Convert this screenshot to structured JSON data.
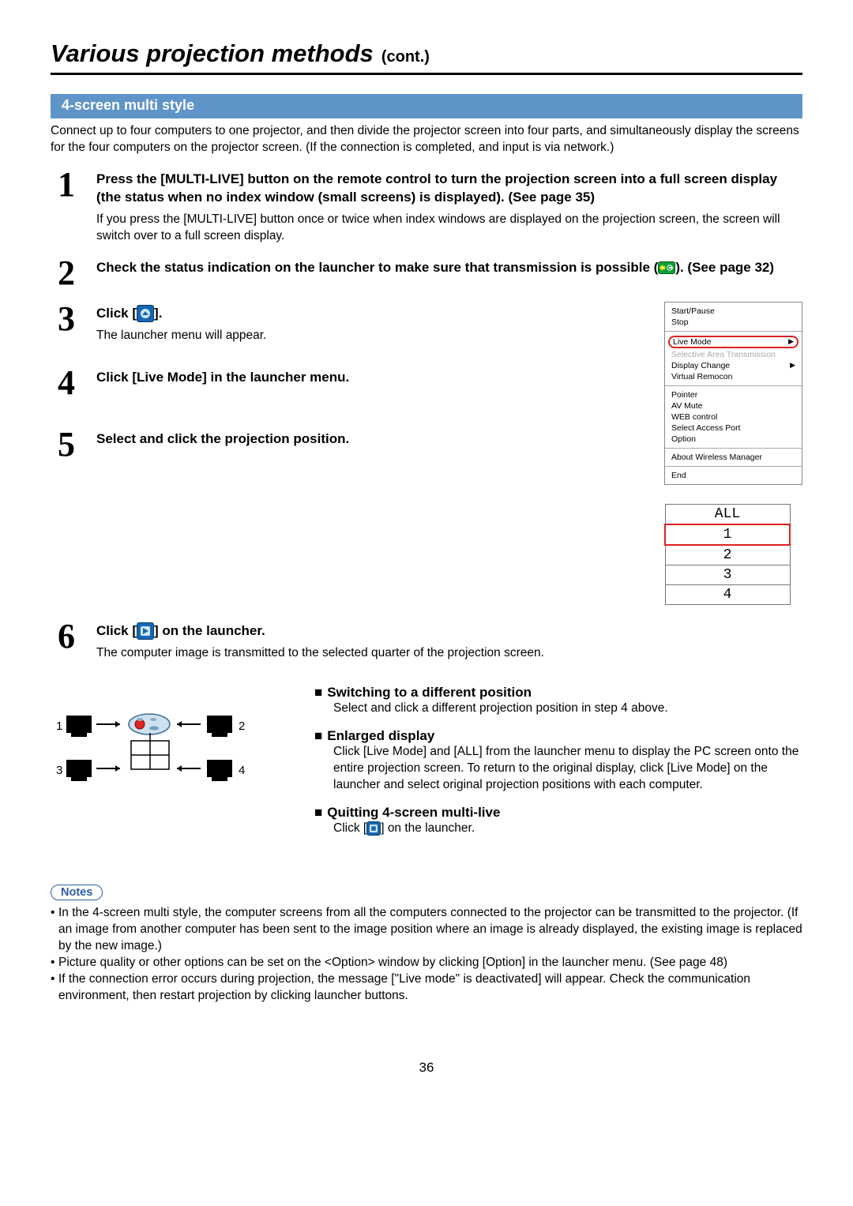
{
  "title": {
    "main": "Various projection methods",
    "sub": "(cont.)"
  },
  "section_bar": "4-screen multi style",
  "intro": "Connect up to four computers to one projector, and then divide the projector screen into four parts, and simultaneously display the screens for the four computers on the projector screen. (If the connection is completed, and input is via network.)",
  "step1": {
    "num": "1",
    "head": "Press the [MULTI-LIVE] button on the remote control to turn the projection screen into a full screen display (the status when no index window (small screens) is displayed). (See page 35)",
    "desc": "If you press the [MULTI-LIVE] button once or twice when index windows are displayed on the projection screen, the screen will switch over to a full screen display."
  },
  "step2": {
    "num": "2",
    "head_a": "Check the status indication on the launcher to make sure that transmission is possible (",
    "head_b": "). (See page 32)"
  },
  "step3": {
    "num": "3",
    "head_a": "Click [",
    "head_b": "].",
    "desc": "The launcher menu will appear."
  },
  "step4": {
    "num": "4",
    "head": "Click [Live Mode] in the launcher menu."
  },
  "step5": {
    "num": "5",
    "head": "Select and click the projection position."
  },
  "step6": {
    "num": "6",
    "head_a": "Click [",
    "head_b": "] on the launcher.",
    "desc": "The computer image is transmitted to the selected quarter of the projection screen."
  },
  "menu": {
    "g1": [
      "Start/Pause",
      "Stop"
    ],
    "live_mode": "Live Mode",
    "g2b": [
      "Selective Area Transmission",
      "Display Change",
      "Virtual Remocon"
    ],
    "g3": [
      "Pointer",
      "AV Mute",
      "WEB control",
      "Select Access Port",
      "Option"
    ],
    "g4": "About Wireless Manager",
    "g5": "End"
  },
  "positions": {
    "all": "ALL",
    "rows": [
      "1",
      "2",
      "3",
      "4"
    ]
  },
  "sub_switch": {
    "title": "Switching to a different position",
    "body": "Select and click a different projection position in step 4 above."
  },
  "sub_enlarged": {
    "title": "Enlarged display",
    "body": "Click [Live Mode] and [ALL] from the launcher menu to display the PC screen onto the entire projection screen. To return to the original display, click [Live Mode] on the launcher and select original projection positions with each computer."
  },
  "sub_quit": {
    "title": "Quitting 4-screen multi-live",
    "body_a": "Click [",
    "body_b": "] on the launcher."
  },
  "diagram": {
    "labels": [
      "1",
      "2",
      "3",
      "4"
    ]
  },
  "notes_label": "Notes",
  "notes": [
    "In the 4-screen multi style, the computer screens from all the computers connected to the projector can be transmitted to the projector. (If an image from another computer has been sent to the image position where an image is already displayed, the existing image is replaced by the new image.)",
    "Picture quality or other options can be set on the <Option> window by clicking [Option] in the launcher menu. (See page 48)",
    "If the connection error occurs during projection, the message [\"Live mode\" is deactivated] will appear. Check the communication environment, then restart projection by clicking launcher buttons."
  ],
  "page_num": "36"
}
